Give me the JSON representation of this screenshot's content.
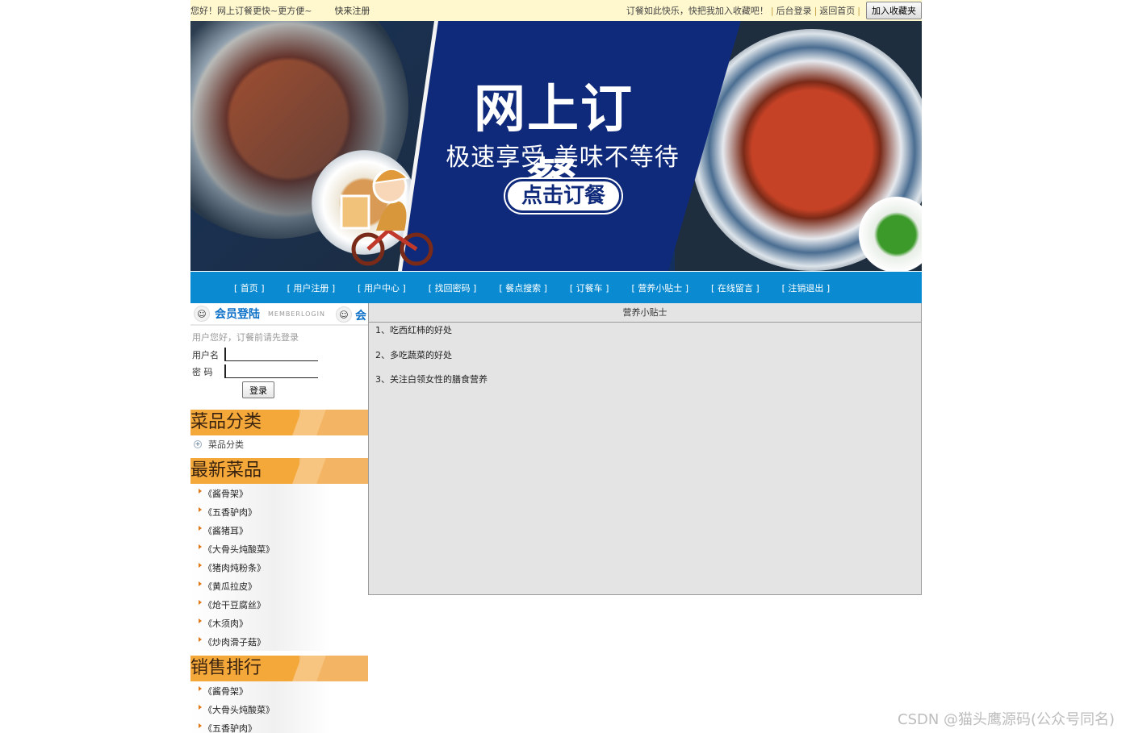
{
  "topbar": {
    "greeting": "您好！网上订餐更快~更方便~",
    "register": "快来注册",
    "slogan": "订餐如此快乐，快把我加入收藏吧！",
    "admin_login": "后台登录",
    "back_home": "返回首页",
    "add_favorite": "加入收藏夹"
  },
  "banner": {
    "title": "网上订餐",
    "subtitle": "极速享受 美味不等待",
    "cta": "点击订餐"
  },
  "nav": [
    "[ 首页 ]",
    "[ 用户注册 ]",
    "[ 用户中心 ]",
    "[ 找回密码 ]",
    "[ 餐点搜索 ]",
    "[ 订餐车 ]",
    "[ 营养小贴士 ]",
    "[ 在线留言 ]",
    "[ 注销退出 ]"
  ],
  "login": {
    "title": "会员登陆",
    "title_en": "MEMBERLOGIN",
    "title_right": "会",
    "hint": "用户您好，订餐前请先登录",
    "username_label": "用户名",
    "password_label": "密  码",
    "button": "登录"
  },
  "categories": {
    "title": "菜品分类",
    "items": [
      "菜品分类"
    ]
  },
  "latest": {
    "title": "最新菜品",
    "items": [
      "《酱骨架》",
      "《五香驴肉》",
      "《酱猪耳》",
      "《大骨头炖酸菜》",
      "《猪肉炖粉条》",
      "《黄瓜拉皮》",
      "《炝干豆腐丝》",
      "《木须肉》",
      "《炒肉滑子菇》"
    ]
  },
  "ranking": {
    "title": "销售排行",
    "items": [
      "《酱骨架》",
      "《大骨头炖酸菜》",
      "《五香驴肉》"
    ]
  },
  "main": {
    "title": "营养小贴士",
    "tips": [
      "1、吃西红柿的好处",
      "2、多吃蔬菜的好处",
      "3、关注白领女性的膳食营养"
    ]
  },
  "watermark": "CSDN @猫头鹰源码(公众号同名)"
}
